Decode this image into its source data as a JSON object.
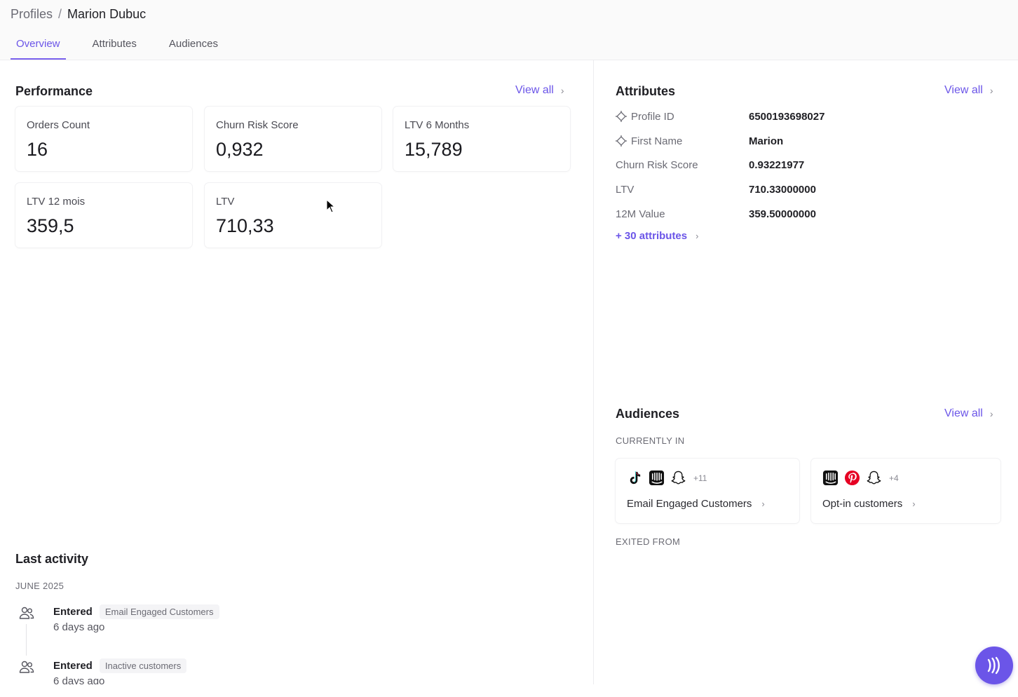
{
  "breadcrumb": {
    "root": "Profiles",
    "separator": "/",
    "current": "Marion Dubuc"
  },
  "tabs": [
    {
      "label": "Overview",
      "active": true
    },
    {
      "label": "Attributes",
      "active": false
    },
    {
      "label": "Audiences",
      "active": false
    }
  ],
  "performance": {
    "title": "Performance",
    "view_all": "View all",
    "cards": [
      {
        "label": "Orders Count",
        "value": "16"
      },
      {
        "label": "Churn Risk Score",
        "value": "0,932"
      },
      {
        "label": "LTV 6 Months",
        "value": "15,789"
      },
      {
        "label": "LTV 12 mois",
        "value": "359,5"
      },
      {
        "label": "LTV",
        "value": "710,33"
      }
    ]
  },
  "attributes": {
    "title": "Attributes",
    "view_all": "View all",
    "rows": [
      {
        "key": "Profile ID",
        "value": "6500193698027",
        "icon": "identifier-icon"
      },
      {
        "key": "First Name",
        "value": "Marion",
        "icon": "identifier-icon"
      },
      {
        "key": "Churn Risk Score",
        "value": "0.93221977"
      },
      {
        "key": "LTV",
        "value": "710.33000000"
      },
      {
        "key": "12M Value",
        "value": "359.50000000"
      }
    ],
    "more_label": "+ 30 attributes"
  },
  "audiences": {
    "title": "Audiences",
    "view_all": "View all",
    "currently_in_label": "CURRENTLY IN",
    "exited_from_label": "EXITED FROM",
    "currently_in": [
      {
        "name": "Email Engaged Customers",
        "icons": [
          "tiktok-icon",
          "intercom-icon",
          "snapchat-icon"
        ],
        "more": "+11"
      },
      {
        "name": "Opt-in customers",
        "icons": [
          "intercom-icon",
          "pinterest-icon",
          "snapchat-icon"
        ],
        "more": "+4"
      }
    ]
  },
  "last_activity": {
    "title": "Last activity",
    "month": "JUNE 2025",
    "items": [
      {
        "verb": "Entered",
        "audience": "Email Engaged Customers",
        "time": "6 days ago"
      },
      {
        "verb": "Entered",
        "audience": "Inactive customers",
        "time": "6 days ago"
      }
    ]
  },
  "colors": {
    "accent": "#6b55e8",
    "pinterest": "#e60023"
  }
}
